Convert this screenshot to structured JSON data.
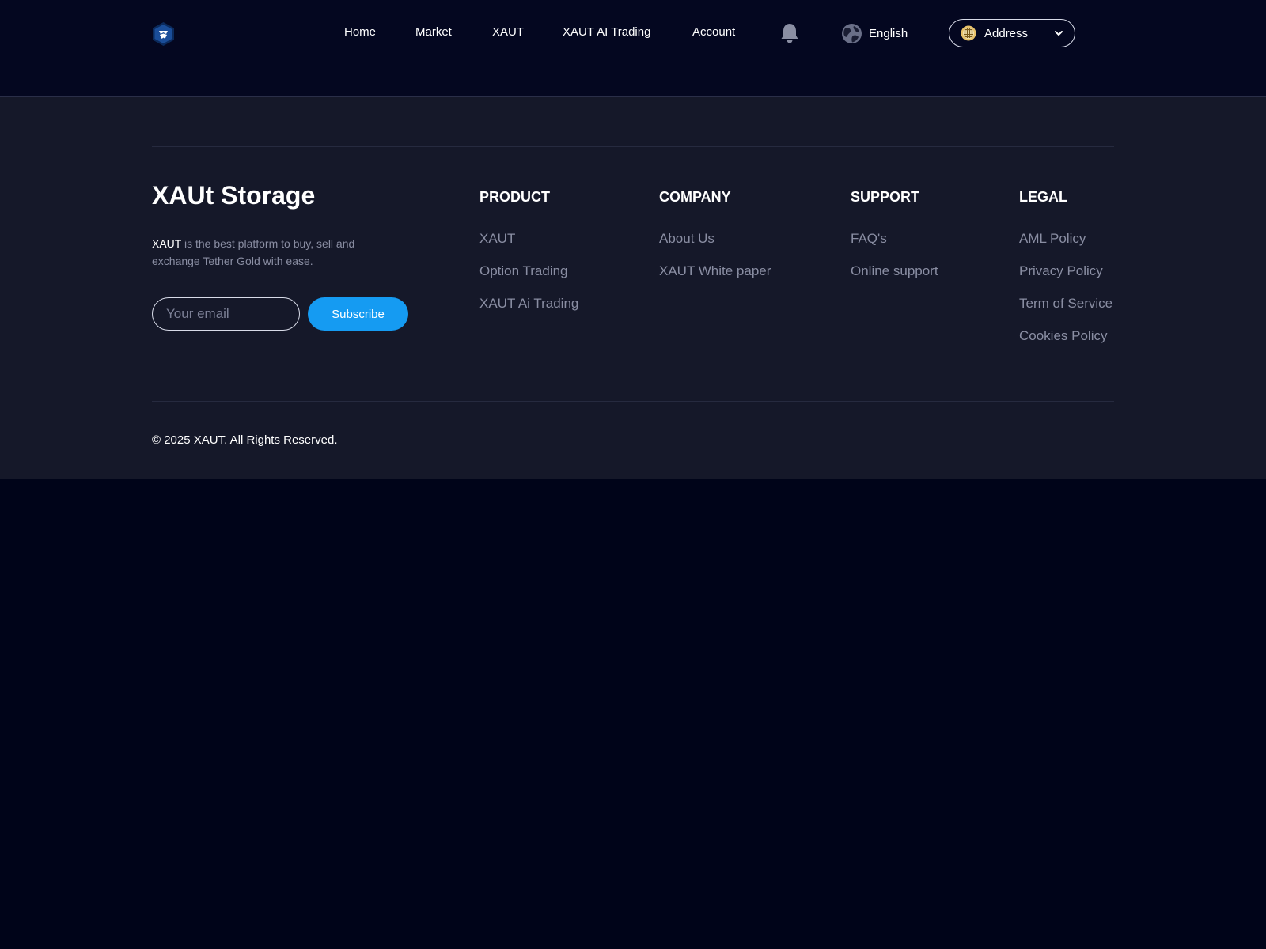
{
  "header": {
    "nav": [
      {
        "label": "Home",
        "name": "nav-home"
      },
      {
        "label": "Market",
        "name": "nav-market"
      },
      {
        "label": "XAUT",
        "name": "nav-xaut"
      },
      {
        "label": "XAUT AI Trading",
        "name": "nav-xaut-ai-trading"
      },
      {
        "label": "Account",
        "name": "nav-account"
      }
    ],
    "language": "English",
    "address_label": "Address",
    "icons": {
      "logo": "crypto-com-logo-icon",
      "bell": "bell-icon",
      "globe": "globe-icon",
      "wallet": "coin-icon",
      "chevron": "chevron-down-icon"
    }
  },
  "footer": {
    "brand": {
      "title": "XAUt Storage",
      "desc_highlight": "XAUT",
      "desc_rest": " is the best platform to buy, sell and exchange Tether Gold with ease."
    },
    "newsletter": {
      "placeholder": "Your email",
      "button": "Subscribe"
    },
    "columns": {
      "product": {
        "title": "PRODUCT",
        "links": [
          "XAUT",
          "Option Trading",
          "XAUT Ai Trading"
        ]
      },
      "company": {
        "title": "COMPANY",
        "links": [
          "About Us",
          "XAUT White paper"
        ]
      },
      "support": {
        "title": "SUPPORT",
        "links": [
          "FAQ's",
          "Online support"
        ]
      },
      "legal": {
        "title": "LEGAL",
        "links": [
          "AML Policy",
          "Privacy Policy",
          "Term of Service",
          "Cookies Policy"
        ]
      }
    },
    "copyright": "© 2025 XAUT. All Rights Reserved."
  },
  "colors": {
    "page_bg": "#000419",
    "header_bg": "#040720",
    "footer_bg": "#151829",
    "accent": "#159bf2",
    "muted_text": "#8a8ea3"
  }
}
